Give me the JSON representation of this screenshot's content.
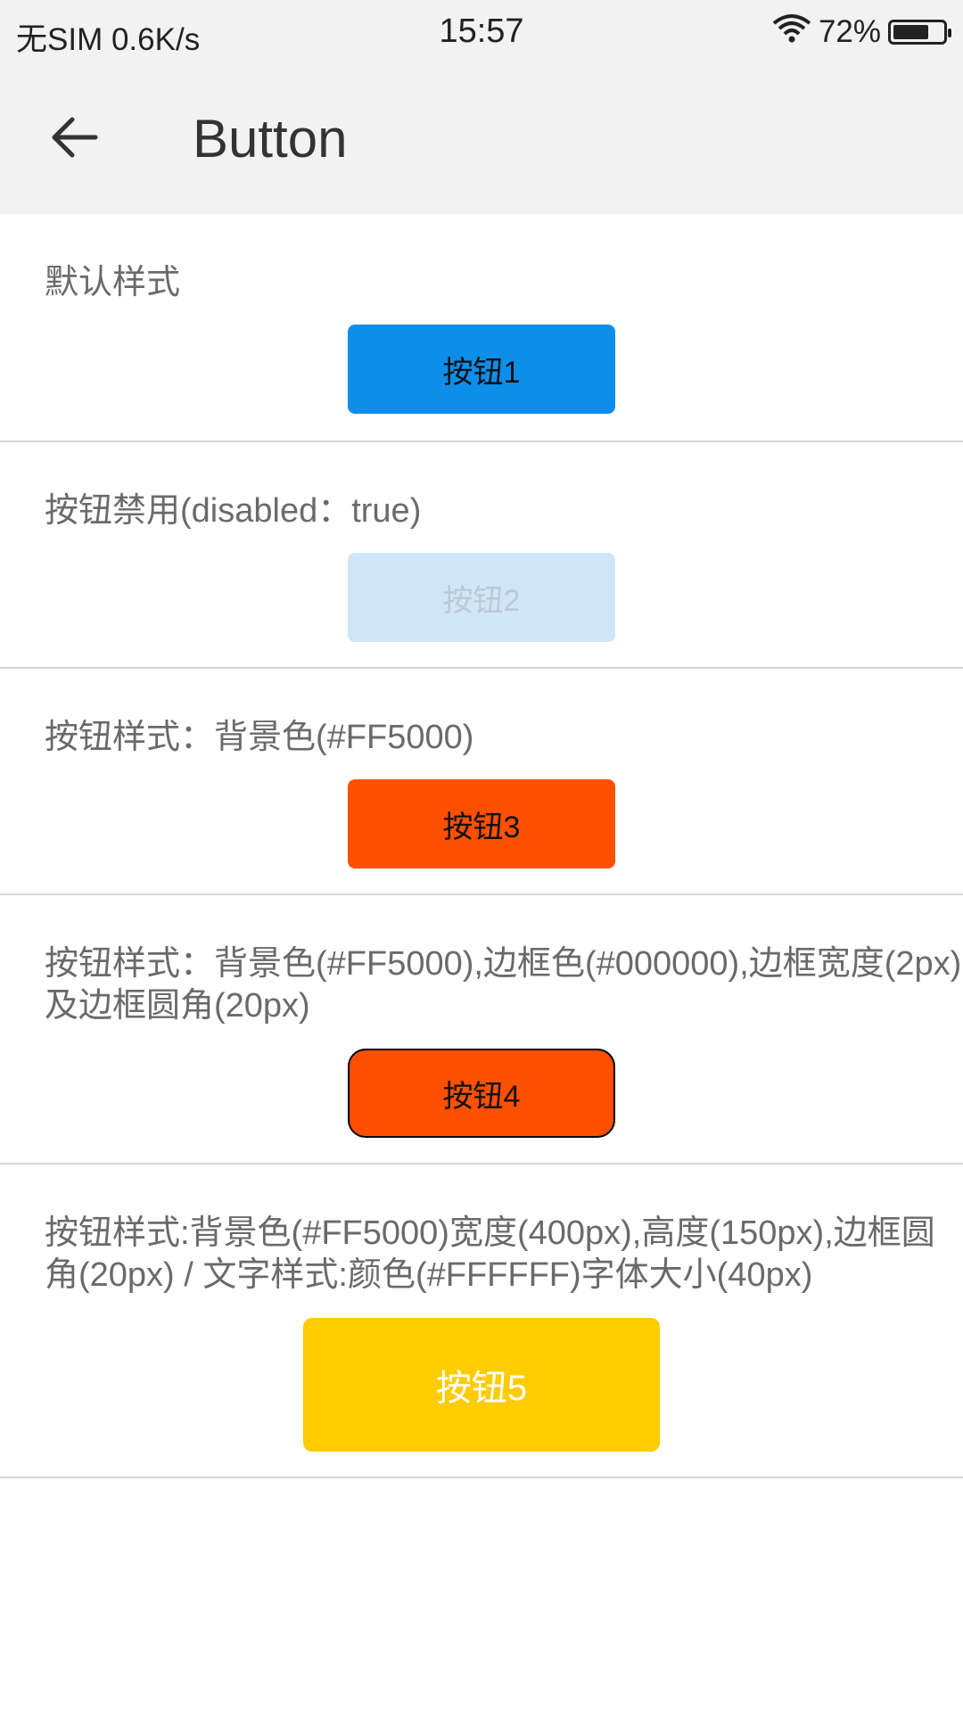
{
  "status_bar": {
    "carrier": "无SIM",
    "speed": "0.6K/s",
    "time": "15:57",
    "battery_percent": "72%",
    "battery_level": 0.72,
    "icons": [
      "wifi-icon",
      "battery-icon"
    ]
  },
  "app_bar": {
    "back_icon": "back-arrow-icon",
    "title": "Button"
  },
  "sections": [
    {
      "label": "默认样式",
      "button": "按钮1",
      "button_color": "#0d8ee9",
      "disabled": false
    },
    {
      "label": "按钮禁用(disabled：true)",
      "button": "按钮2",
      "button_color": "#cfe6f8",
      "disabled": true
    },
    {
      "label": "按钮样式：背景色(#FF5000)",
      "button": "按钮3",
      "button_color": "#ff5000",
      "disabled": false
    },
    {
      "label": "按钮样式：背景色(#FF5000),边框色(#000000),边框宽度(2px) 及边框圆角(20px)",
      "button": "按钮4",
      "button_color": "#ff5000",
      "disabled": false
    },
    {
      "label": "按钮样式:背景色(#FF5000)宽度(400px),高度(150px),边框圆角(20px) / 文字样式:颜色(#FFFFFF)字体大小(40px)",
      "button": "按钮5",
      "button_color": "#ffcc00",
      "disabled": false
    }
  ]
}
